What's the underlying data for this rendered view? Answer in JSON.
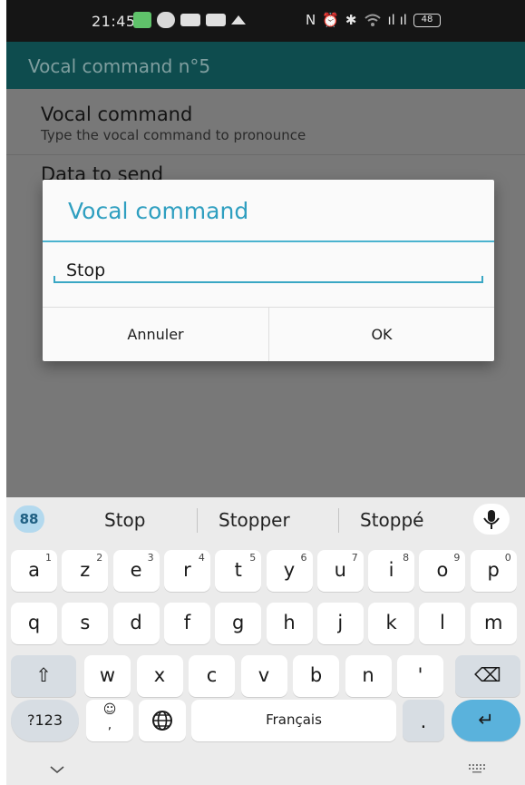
{
  "status_bar": {
    "time": "21:45",
    "nfc_glyph": "N",
    "alarm_glyph": "⏰",
    "bluetooth_glyph": "✱",
    "signal_glyph": "ıl ıl",
    "battery": "48"
  },
  "app_bar": {
    "title": "Vocal command n°5"
  },
  "settings": [
    {
      "title": "Vocal command",
      "summary": "Type the vocal command to pronounce"
    },
    {
      "title": "Data to send",
      "summary": ""
    }
  ],
  "dialog": {
    "title": "Vocal command",
    "input_value": "Stop",
    "cancel_label": "Annuler",
    "ok_label": "OK",
    "accent_color": "#2f9fc0"
  },
  "keyboard": {
    "suggestions": [
      "Stop",
      "Stopper",
      "Stoppé"
    ],
    "row1": [
      {
        "key": "a",
        "sup": "1"
      },
      {
        "key": "z",
        "sup": "2"
      },
      {
        "key": "e",
        "sup": "3"
      },
      {
        "key": "r",
        "sup": "4"
      },
      {
        "key": "t",
        "sup": "5"
      },
      {
        "key": "y",
        "sup": "6"
      },
      {
        "key": "u",
        "sup": "7"
      },
      {
        "key": "i",
        "sup": "8"
      },
      {
        "key": "o",
        "sup": "9"
      },
      {
        "key": "p",
        "sup": "0"
      }
    ],
    "row2": [
      "q",
      "s",
      "d",
      "f",
      "g",
      "h",
      "j",
      "k",
      "l",
      "m"
    ],
    "row3": [
      "w",
      "x",
      "c",
      "v",
      "b",
      "n",
      "'"
    ],
    "symbols_label": "?123",
    "emoji_key": "☺",
    "emoji_sub": ",",
    "space_label": "Français",
    "period_label": ".",
    "shift_glyph": "⇧",
    "backspace_glyph": "⌫",
    "enter_glyph": "↵",
    "menu_glyph": "88",
    "icons": [
      "menu-grid-icon",
      "microphone-icon",
      "shift-icon",
      "backspace-icon",
      "globe-icon",
      "enter-icon",
      "chevron-down-icon",
      "keyboard-switch-icon"
    ]
  }
}
